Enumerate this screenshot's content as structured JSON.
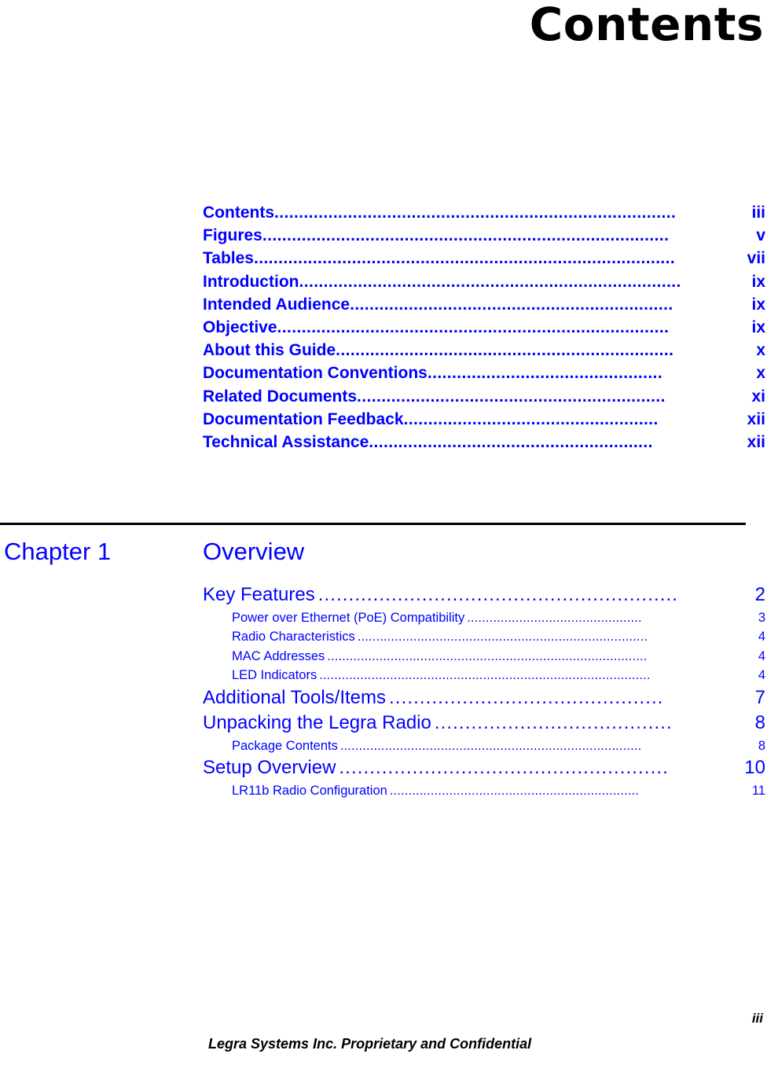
{
  "page": {
    "title": "Contents",
    "accent_color": "#0000ff",
    "text_color": "#000000"
  },
  "frontmatter": {
    "entries": [
      {
        "label": "Contents",
        "leader": "..................................................................................",
        "page": "iii"
      },
      {
        "label": "Figures ",
        "leader": "...................................................................................",
        "page": "v"
      },
      {
        "label": "Tables",
        "leader": "......................................................................................",
        "page": "vii"
      },
      {
        "label": "Introduction ",
        "leader": "..............................................................................",
        "page": "ix"
      },
      {
        "label": "Intended Audience ",
        "leader": "..................................................................",
        "page": "ix"
      },
      {
        "label": "Objective ",
        "leader": "................................................................................",
        "page": "ix"
      },
      {
        "label": "About this Guide ",
        "leader": ".....................................................................",
        "page": "x"
      },
      {
        "label": "Documentation Conventions ",
        "leader": "................................................",
        "page": "x"
      },
      {
        "label": "Related Documents ",
        "leader": "...............................................................",
        "page": "xi"
      },
      {
        "label": "Documentation Feedback ",
        "leader": "....................................................",
        "page": "xii"
      },
      {
        "label": "Technical Assistance ",
        "leader": "..........................................................",
        "page": "xii"
      }
    ]
  },
  "chapter": {
    "number_label": "Chapter 1",
    "name": "Overview",
    "entries": [
      {
        "level": 1,
        "label": "Key Features ",
        "leader": "...........................................................",
        "page": "2"
      },
      {
        "level": 2,
        "label": "Power over Ethernet (PoE) Compatibility ",
        "leader": "...............................................",
        "page": "3"
      },
      {
        "level": 2,
        "label": "Radio Characteristics ",
        "leader": "..............................................................................",
        "page": "4"
      },
      {
        "level": 2,
        "label": "MAC Addresses ",
        "leader": "......................................................................................",
        "page": "4"
      },
      {
        "level": 2,
        "label": "LED Indicators ",
        "leader": ".........................................................................................",
        "page": "4"
      },
      {
        "level": 1,
        "label": "Additional Tools/Items ",
        "leader": ".............................................",
        "page": "7"
      },
      {
        "level": 1,
        "label": "Unpacking the Legra Radio ",
        "leader": ".......................................",
        "page": "8"
      },
      {
        "level": 2,
        "label": "Package Contents ",
        "leader": ".................................................................................",
        "page": "8"
      },
      {
        "level": 1,
        "label": "Setup Overview ",
        "leader": "......................................................",
        "page": "10"
      },
      {
        "level": 2,
        "label": "LR11b Radio Configuration ",
        "leader": "...................................................................",
        "page": "11"
      }
    ]
  },
  "footer": {
    "page_number": "iii",
    "notice": "Legra Systems Inc. Proprietary and Confidential"
  }
}
